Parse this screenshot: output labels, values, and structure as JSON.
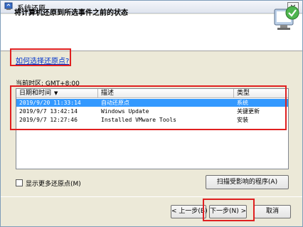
{
  "window": {
    "title": "系统还原",
    "close_glyph": "×"
  },
  "header": {
    "title": "将计算机还原到所选事件之前的状态"
  },
  "link": {
    "text": "如何选择还原点?"
  },
  "timezone": {
    "label": "当前时区: GMT+8:00"
  },
  "table": {
    "columns": [
      "日期和时间",
      "描述",
      "类型"
    ],
    "rows": [
      {
        "datetime": "2019/9/20 11:33:14",
        "description": "自动还原点",
        "type": "系统",
        "selected": true
      },
      {
        "datetime": "2019/9/7 13:42:14",
        "description": "Windows Update",
        "type": "关键更新",
        "selected": false
      },
      {
        "datetime": "2019/9/7 12:27:46",
        "description": "Installed VMware Tools",
        "type": "安装",
        "selected": false
      }
    ]
  },
  "options": {
    "show_more_label": "显示更多还原点(M)",
    "show_more_checked": false
  },
  "buttons": {
    "scan": "扫描受影响的程序(A)",
    "prev": "< 上一步(B)",
    "next": "下一步(N) >",
    "cancel": "取消"
  },
  "colors": {
    "highlight": "#e02020",
    "selection": "#3399ff",
    "link": "#0033cc"
  }
}
